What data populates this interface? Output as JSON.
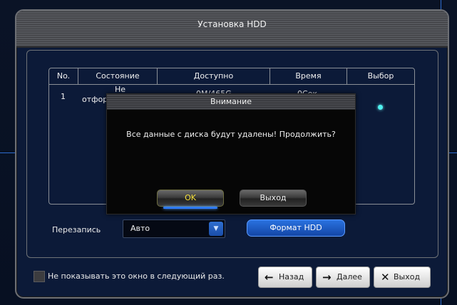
{
  "window": {
    "title": "Установка HDD"
  },
  "table": {
    "headers": [
      "No.",
      "Состояние",
      "Доступно",
      "Время",
      "Выбор"
    ],
    "row": {
      "no": "1",
      "status_line1": "Не",
      "status_line2": "отфор",
      "available": "0M/465G",
      "time": "0Сек",
      "selected": true
    }
  },
  "overwrite": {
    "label": "Перезапись",
    "value": "Авто"
  },
  "format_button": "Формат HDD",
  "bottom": {
    "checkbox_label": "Не показывать это окно в следующий раз.",
    "back": "Назад",
    "next": "Далее",
    "exit": "Выход"
  },
  "dialog": {
    "title": "Внимание",
    "message": "Все данные с диска будут удалены!  Продолжить?",
    "ok": "OK",
    "exit": "Выход"
  },
  "colors": {
    "accent": "#2e6ccf",
    "select_dot": "#4ff2f0",
    "ok_text": "#f6e03a"
  }
}
